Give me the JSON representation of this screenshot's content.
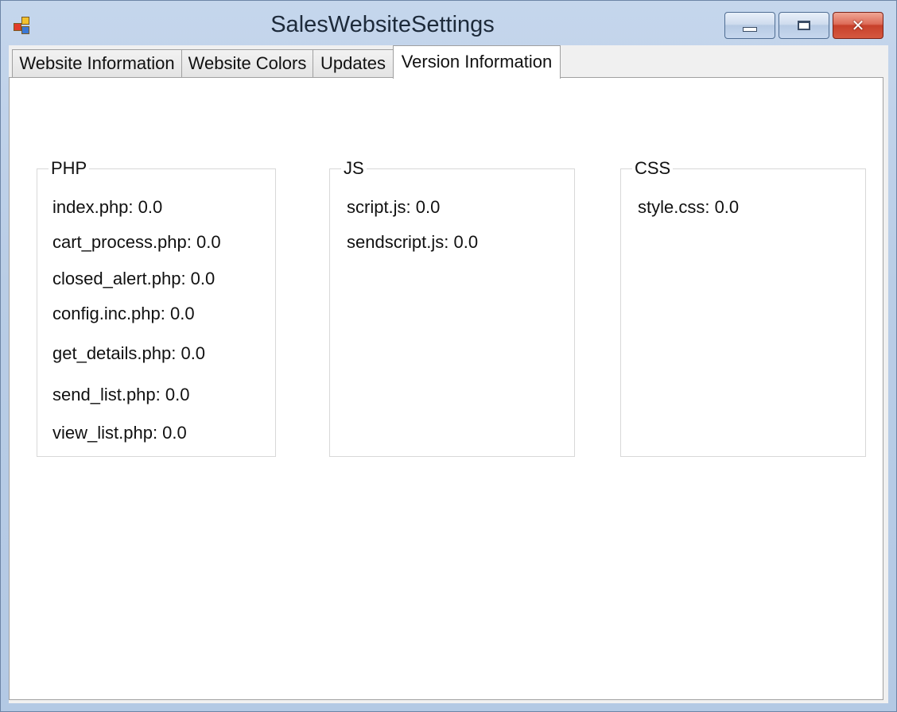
{
  "window": {
    "title": "SalesWebsiteSettings"
  },
  "caption_buttons": {
    "minimize_icon": "minimize-icon",
    "maximize_icon": "maximize-icon",
    "close_icon": "close-icon",
    "close_glyph": "✕"
  },
  "colors": {
    "title_bar": "#b9cde6",
    "close_button": "#c7402b",
    "tab_page_background": "#ffffff"
  },
  "tabs": [
    {
      "label": "Website Information",
      "selected": false
    },
    {
      "label": "Website Colors",
      "selected": false
    },
    {
      "label": "Updates",
      "selected": false
    },
    {
      "label": "Version Information",
      "selected": true
    }
  ],
  "groups": {
    "php": {
      "title": "PHP",
      "items": [
        "index.php: 0.0",
        "cart_process.php: 0.0",
        "closed_alert.php: 0.0",
        "config.inc.php: 0.0",
        "get_details.php: 0.0",
        "send_list.php: 0.0",
        "view_list.php: 0.0"
      ]
    },
    "js": {
      "title": "JS",
      "items": [
        "script.js: 0.0",
        "sendscript.js: 0.0"
      ]
    },
    "css": {
      "title": "CSS",
      "items": [
        "style.css: 0.0"
      ]
    }
  }
}
